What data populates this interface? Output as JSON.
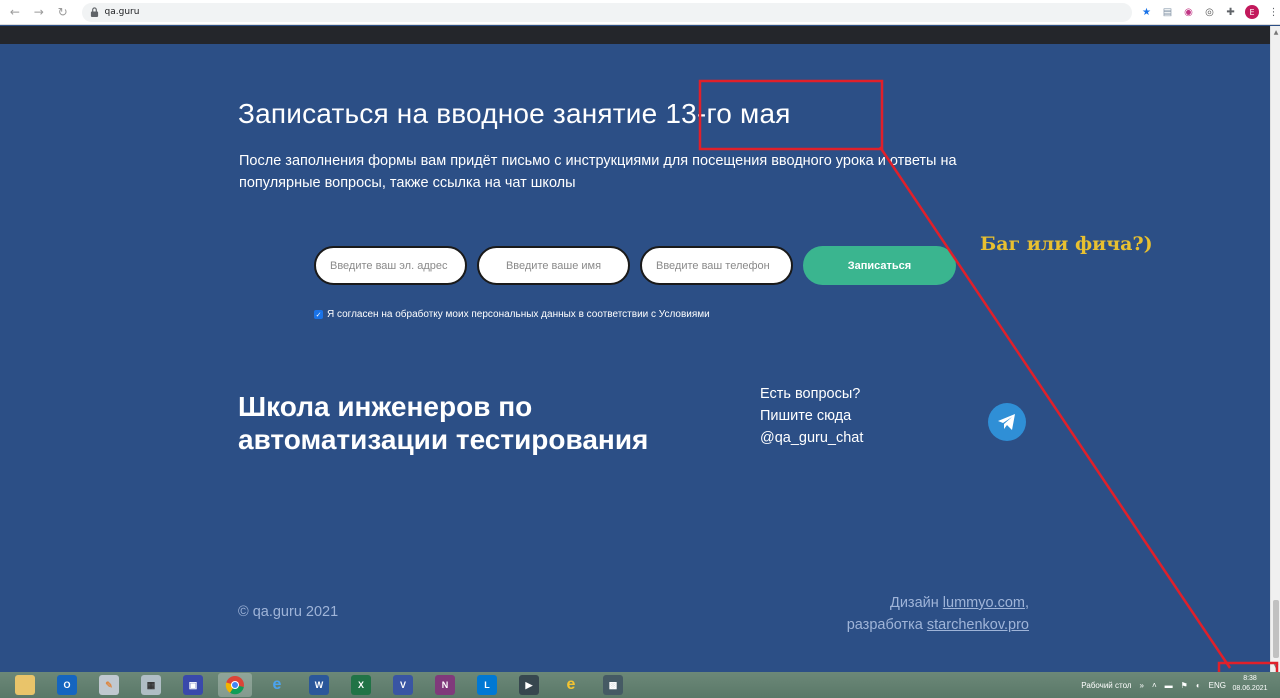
{
  "browser": {
    "url": "qa.guru",
    "profile_initial": "E"
  },
  "form_section": {
    "heading": "Записаться на вводное занятие 13-го мая",
    "description": "После заполнения формы вам придёт письмо с инструкциями для посещения вводного урока и ответы на популярные вопросы, также ссылка на чат школы",
    "email_placeholder": "Введите ваш эл. адрес",
    "name_placeholder": "Введите ваше имя",
    "phone_placeholder": "Введите ваш телефон",
    "submit_label": "Записаться",
    "consent_text": "Я согласен на обработку моих персональных данных в соответствии с Условиями",
    "consent_checked": true
  },
  "school": {
    "title": "Школа инженеров по автоматизации тестирования",
    "contact_line1": "Есть вопросы?",
    "contact_line2": "Пишите сюда",
    "contact_handle": "@qa_guru_chat"
  },
  "footer": {
    "copyright": "© qa.guru 2021",
    "design_prefix": "Дизайн",
    "design_link": "lummyo.com",
    "design_suffix": ",",
    "dev_prefix": "разработка",
    "dev_link": "starchenkov.pro"
  },
  "annotation": {
    "text": "Баг или фича?)",
    "color": "#e8c030",
    "box_color": "#e0202a"
  },
  "taskbar": {
    "tray_label": "Рабочий стол",
    "tray_chevron": "»",
    "language": "ENG",
    "time": "8:38",
    "date": "08.06.2021"
  },
  "colors": {
    "page_bg": "#2c4f86",
    "submit_bg": "#3ab58f",
    "telegram": "#2f8fd6"
  }
}
